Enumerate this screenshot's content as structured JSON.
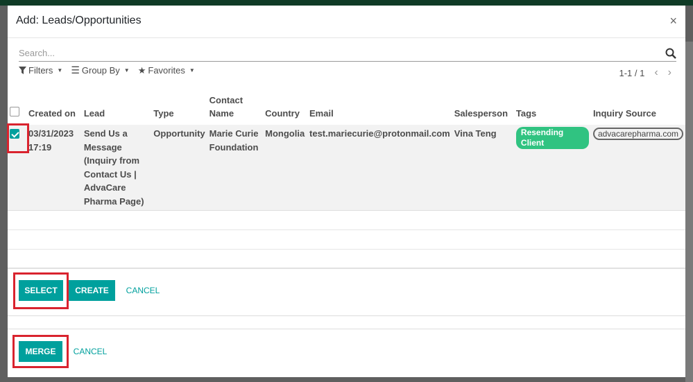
{
  "dialog": {
    "title": "Add: Leads/Opportunities",
    "close_glyph": "×"
  },
  "search": {
    "placeholder": "Search..."
  },
  "filters": {
    "filters_label": "Filters",
    "group_by_label": "Group By",
    "favorites_label": "Favorites"
  },
  "pager": {
    "text": "1-1 / 1"
  },
  "table": {
    "headers": {
      "created_on": "Created on",
      "lead": "Lead",
      "type": "Type",
      "contact_name": "Contact Name",
      "country": "Country",
      "email": "Email",
      "salesperson": "Salesperson",
      "tags": "Tags",
      "inquiry_source": "Inquiry Source"
    },
    "rows": [
      {
        "selected": true,
        "created_on": "03/31/2023 17:19",
        "lead": "Send Us a Message (Inquiry from Contact Us | AdvaCare Pharma Page)",
        "type": "Opportunity",
        "contact_name": "Marie Curie Foundation",
        "country": "Mongolia",
        "email": "test.mariecurie@protonmail.com",
        "salesperson": "Vina Teng",
        "tag": "Resending Client",
        "inquiry_source": "advacarepharma.com"
      }
    ]
  },
  "footer_select": {
    "select_label": "SELECT",
    "create_label": "CREATE",
    "cancel_label": "CANCEL"
  },
  "footer_merge": {
    "merge_label": "MERGE",
    "cancel_label": "CANCEL"
  },
  "colors": {
    "accent": "#00a09d",
    "tag_green": "#30c381",
    "highlight_red": "#d9232e"
  }
}
